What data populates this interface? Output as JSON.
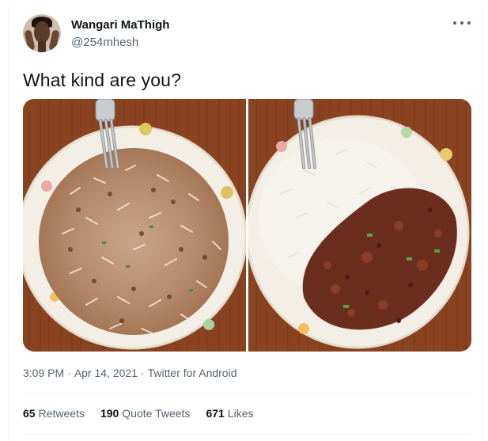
{
  "tweet": {
    "display_name": "Wangari MaThigh",
    "handle": "@254mhesh",
    "text": "What kind are you?",
    "time": "3:09 PM",
    "date": "Apr 14, 2021",
    "source": "Twitter for Android",
    "separator": "·",
    "more_icon": "more-horizontal-icon"
  },
  "stats": [
    {
      "count": "65",
      "label": "Retweets"
    },
    {
      "count": "190",
      "label": "Quote Tweets"
    },
    {
      "count": "671",
      "label": "Likes"
    }
  ],
  "colors": {
    "text_primary": "#0f1419",
    "text_secondary": "#536471",
    "divider": "#eff3f4",
    "table_wood": "#8a4320",
    "rice": "#f4f1ea",
    "mince": "#6b2e1e"
  }
}
